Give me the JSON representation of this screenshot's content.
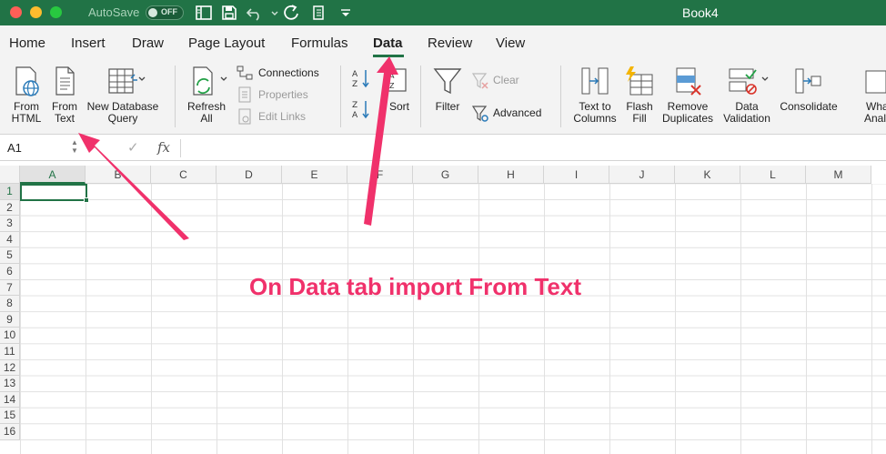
{
  "titlebar": {
    "autosave_label": "AutoSave",
    "autosave_state": "OFF",
    "document_title": "Book4",
    "icons": [
      "sidebar-icon",
      "save-icon",
      "undo-icon",
      "redo-icon",
      "print-icon",
      "customize-icon"
    ]
  },
  "tabs": [
    {
      "label": "Home"
    },
    {
      "label": "Insert"
    },
    {
      "label": "Draw"
    },
    {
      "label": "Page Layout"
    },
    {
      "label": "Formulas"
    },
    {
      "label": "Data",
      "active": true
    },
    {
      "label": "Review"
    },
    {
      "label": "View"
    }
  ],
  "ribbon": {
    "from_html": {
      "line1": "From",
      "line2": "HTML"
    },
    "from_text": {
      "line1": "From",
      "line2": "Text"
    },
    "new_db_query": {
      "line1": "New Database",
      "line2": "Query"
    },
    "refresh_all": {
      "line1": "Refresh",
      "line2": "All"
    },
    "connections": "Connections",
    "properties": "Properties",
    "edit_links": "Edit Links",
    "sort": "Sort",
    "filter": "Filter",
    "clear": "Clear",
    "advanced": "Advanced",
    "text_to_columns": {
      "line1": "Text to",
      "line2": "Columns"
    },
    "flash_fill": {
      "line1": "Flash",
      "line2": "Fill"
    },
    "remove_duplicates": {
      "line1": "Remove",
      "line2": "Duplicates"
    },
    "data_validation": {
      "line1": "Data",
      "line2": "Validation"
    },
    "consolidate": "Consolidate",
    "what_if": {
      "line1": "What",
      "line2": "Anal"
    }
  },
  "formula_bar": {
    "name_box": "A1",
    "fx": "fx"
  },
  "sheet": {
    "columns": [
      "A",
      "B",
      "C",
      "D",
      "E",
      "F",
      "G",
      "H",
      "I",
      "J",
      "K",
      "L",
      "M"
    ],
    "rows": [
      "1",
      "2",
      "3",
      "4",
      "5",
      "6",
      "7",
      "8",
      "9",
      "10",
      "11",
      "12",
      "13",
      "14",
      "15",
      "16"
    ],
    "selected_cell": "A1"
  },
  "annotation": {
    "text": "On Data tab import From Text",
    "color": "#f0316b"
  },
  "colors": {
    "accent": "#217346",
    "annotation": "#f0316b"
  }
}
